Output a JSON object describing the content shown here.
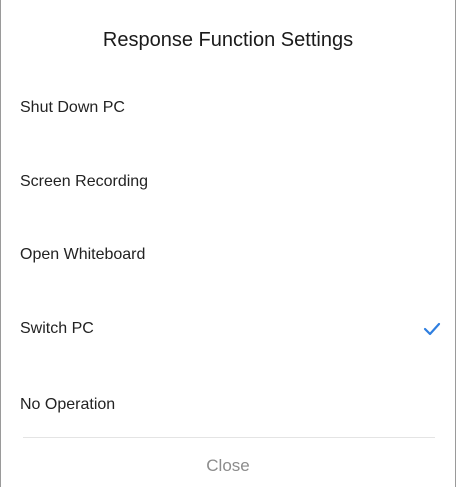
{
  "dialog": {
    "title": "Response Function Settings",
    "options": [
      {
        "label": "Shut Down PC",
        "selected": false
      },
      {
        "label": "Screen Recording",
        "selected": false
      },
      {
        "label": "Open Whiteboard",
        "selected": false
      },
      {
        "label": "Switch PC",
        "selected": true
      },
      {
        "label": "No Operation",
        "selected": false
      }
    ],
    "close_label": "Close",
    "check_icon": "checkmark-icon",
    "accent_color": "#2f7fe0"
  }
}
